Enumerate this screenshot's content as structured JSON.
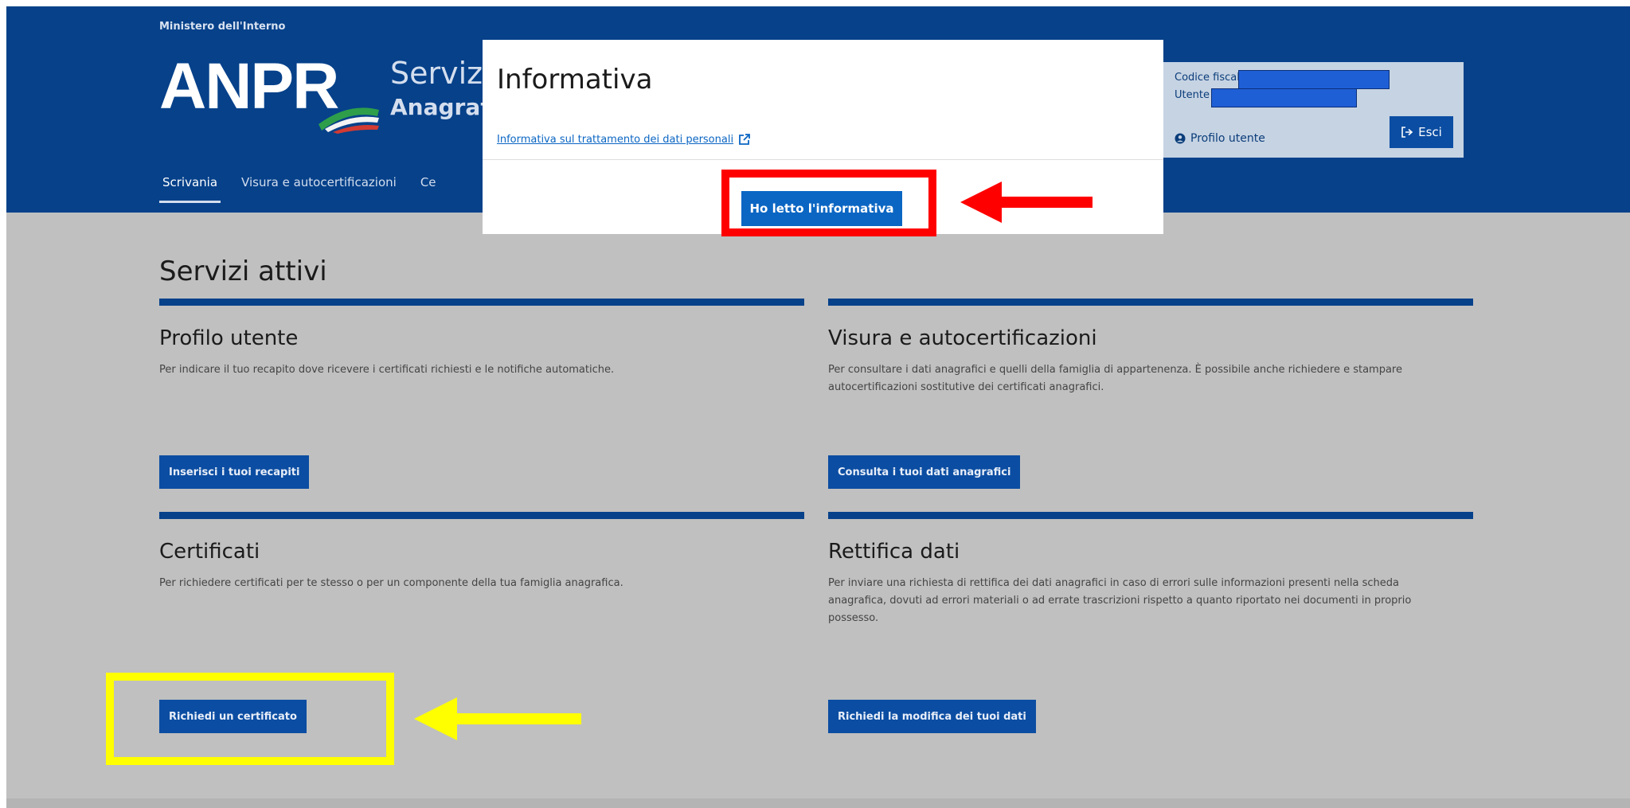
{
  "header": {
    "ministry": "Ministero dell'Interno",
    "logo_text": "ANPR",
    "service_title": "Serviz",
    "service_subtitle": "Anagraf",
    "nav": [
      {
        "label": "Scrivania",
        "active": true
      },
      {
        "label": "Visura e autocertificazioni",
        "active": false
      },
      {
        "label": "Ce",
        "active": false
      }
    ]
  },
  "user_box": {
    "codice_fiscale_label": "Codice fiscale",
    "utente_label": "Utente",
    "profile_link": "Profilo utente",
    "exit_button": "Esci",
    "icons": {
      "profile": "user-circle-icon",
      "exit": "sign-out-icon"
    }
  },
  "main": {
    "page_title": "Servizi attivi",
    "cards": [
      {
        "title": "Profilo utente",
        "description": "Per indicare il tuo recapito dove ricevere i certificati richiesti e le notifiche automatiche.",
        "button": "Inserisci i tuoi recapiti"
      },
      {
        "title": "Visura e autocertificazioni",
        "description": "Per consultare i dati anagrafici e quelli della famiglia di appartenenza. È possibile anche richiedere e stampare autocertificazioni sostitutive dei certificati anagrafici.",
        "button": "Consulta i tuoi dati anagrafici"
      },
      {
        "title": "Certificati",
        "description": "Per richiedere certificati per te stesso o per un componente della tua famiglia anagrafica.",
        "button": "Richiedi un certificato"
      },
      {
        "title": "Rettifica dati",
        "description": "Per inviare una richiesta di rettifica dei dati anagrafici in caso di errori sulle informazioni presenti nella scheda anagrafica, dovuti ad errori materiali o ad errate trascrizioni rispetto a quanto riportato nei documenti in proprio possesso.",
        "button": "Richiedi la modifica dei tuoi dati"
      }
    ]
  },
  "modal": {
    "title": "Informativa",
    "link": "Informativa sul trattamento dei dati personali",
    "link_icon": "external-link-icon",
    "confirm_button": "Ho letto l'informativa"
  },
  "annotations": {
    "red_color": "#ff0000",
    "yellow_color": "#ffff00"
  },
  "colors": {
    "header_blue": "#06418a",
    "button_blue": "#0b4da2",
    "modal_button_blue": "#0b66c3",
    "overlay_gray": "#c0c0c0"
  }
}
